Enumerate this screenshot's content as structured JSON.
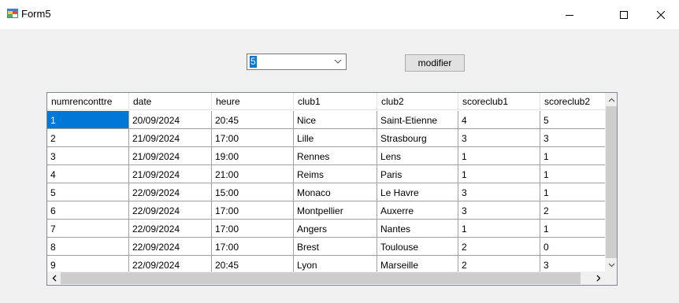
{
  "window": {
    "title": "Form5",
    "icons": [
      "form-icon",
      "minimize-icon",
      "maximize-icon",
      "close-icon"
    ]
  },
  "combo": {
    "value": "5",
    "icon": "chevron-down-icon"
  },
  "button": {
    "label": "modifier"
  },
  "grid": {
    "columns": [
      "numrenconttre",
      "date",
      "heure",
      "club1",
      "club2",
      "scoreclub1",
      "scoreclub2"
    ],
    "rows": [
      [
        "1",
        "20/09/2024",
        "20:45",
        "Nice",
        "Saint-Etienne",
        "4",
        "5"
      ],
      [
        "2",
        "21/09/2024",
        "17:00",
        "Lille",
        "Strasbourg",
        "3",
        "3"
      ],
      [
        "3",
        "21/09/2024",
        "19:00",
        "Rennes",
        "Lens",
        "1",
        "1"
      ],
      [
        "4",
        "21/09/2024",
        "21:00",
        "Reims",
        "Paris",
        "1",
        "1"
      ],
      [
        "5",
        "22/09/2024",
        "15:00",
        "Monaco",
        "Le Havre",
        "3",
        "1"
      ],
      [
        "6",
        "22/09/2024",
        "17:00",
        "Montpellier",
        "Auxerre",
        "3",
        "2"
      ],
      [
        "7",
        "22/09/2024",
        "17:00",
        "Angers",
        "Nantes",
        "1",
        "1"
      ],
      [
        "8",
        "22/09/2024",
        "17:00",
        "Brest",
        "Toulouse",
        "2",
        "0"
      ],
      [
        "9",
        "22/09/2024",
        "20:45",
        "Lyon",
        "Marseille",
        "2",
        "3"
      ]
    ],
    "selected_cell": {
      "row": 0,
      "col": 0
    }
  },
  "colors": {
    "selection": "#0078d7",
    "grid_background": "#ababab",
    "window_background": "#f0f0f0"
  }
}
